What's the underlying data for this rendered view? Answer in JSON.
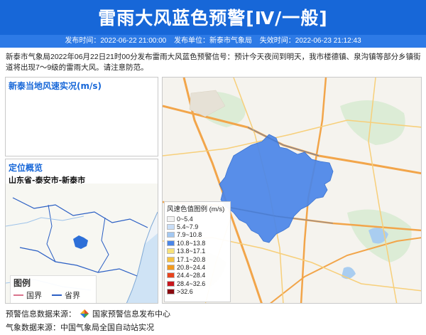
{
  "header": {
    "title": "雷雨大风蓝色预警[Ⅳ/一般]",
    "issue_time": "发布时间：2022-06-22 21:00:00",
    "issuer": "发布单位：新泰市气象局",
    "expire_time": "失效时间：2022-06-23 21:12:43",
    "color": "#1767d8"
  },
  "description": "新泰市气象局2022年06月22日21时00分发布雷雨大风蓝色预警信号：预计今天夜间到明天，我市楼德镇、泉沟镇等部分乡镇街道将出现7～9级的雷雨大风。请注意防范。",
  "wind_panel": {
    "title": "新泰当地风速实况(m/s)"
  },
  "location_panel": {
    "title": "定位概览",
    "region": "山东省-泰安市-新泰市",
    "legend_title": "图例",
    "legend_national": "国界",
    "legend_province": "省界"
  },
  "wind_legend": {
    "title": "风速色值图例 (m/s)",
    "items": [
      {
        "label": "0~5.4",
        "color": "#f2f2f2"
      },
      {
        "label": "5.4~7.9",
        "color": "#c9def7"
      },
      {
        "label": "7.9~10.8",
        "color": "#a3c8f2"
      },
      {
        "label": "10.8~13.8",
        "color": "#4a86e8"
      },
      {
        "label": "13.8~17.1",
        "color": "#f7e27a"
      },
      {
        "label": "17.1~20.8",
        "color": "#f5c242"
      },
      {
        "label": "20.8~24.4",
        "color": "#f29a1f"
      },
      {
        "label": "24.4~28.4",
        "color": "#e8431d"
      },
      {
        "label": "28.4~32.6",
        "color": "#c8161d"
      },
      {
        "label": ">32.6",
        "color": "#8b0a10"
      }
    ]
  },
  "footer": {
    "warning_source": "预警信息数据来源：",
    "warning_source_org": "国家预警信息发布中心",
    "weather_source": "气象数据来源：中国气象局全国自动站实况"
  }
}
